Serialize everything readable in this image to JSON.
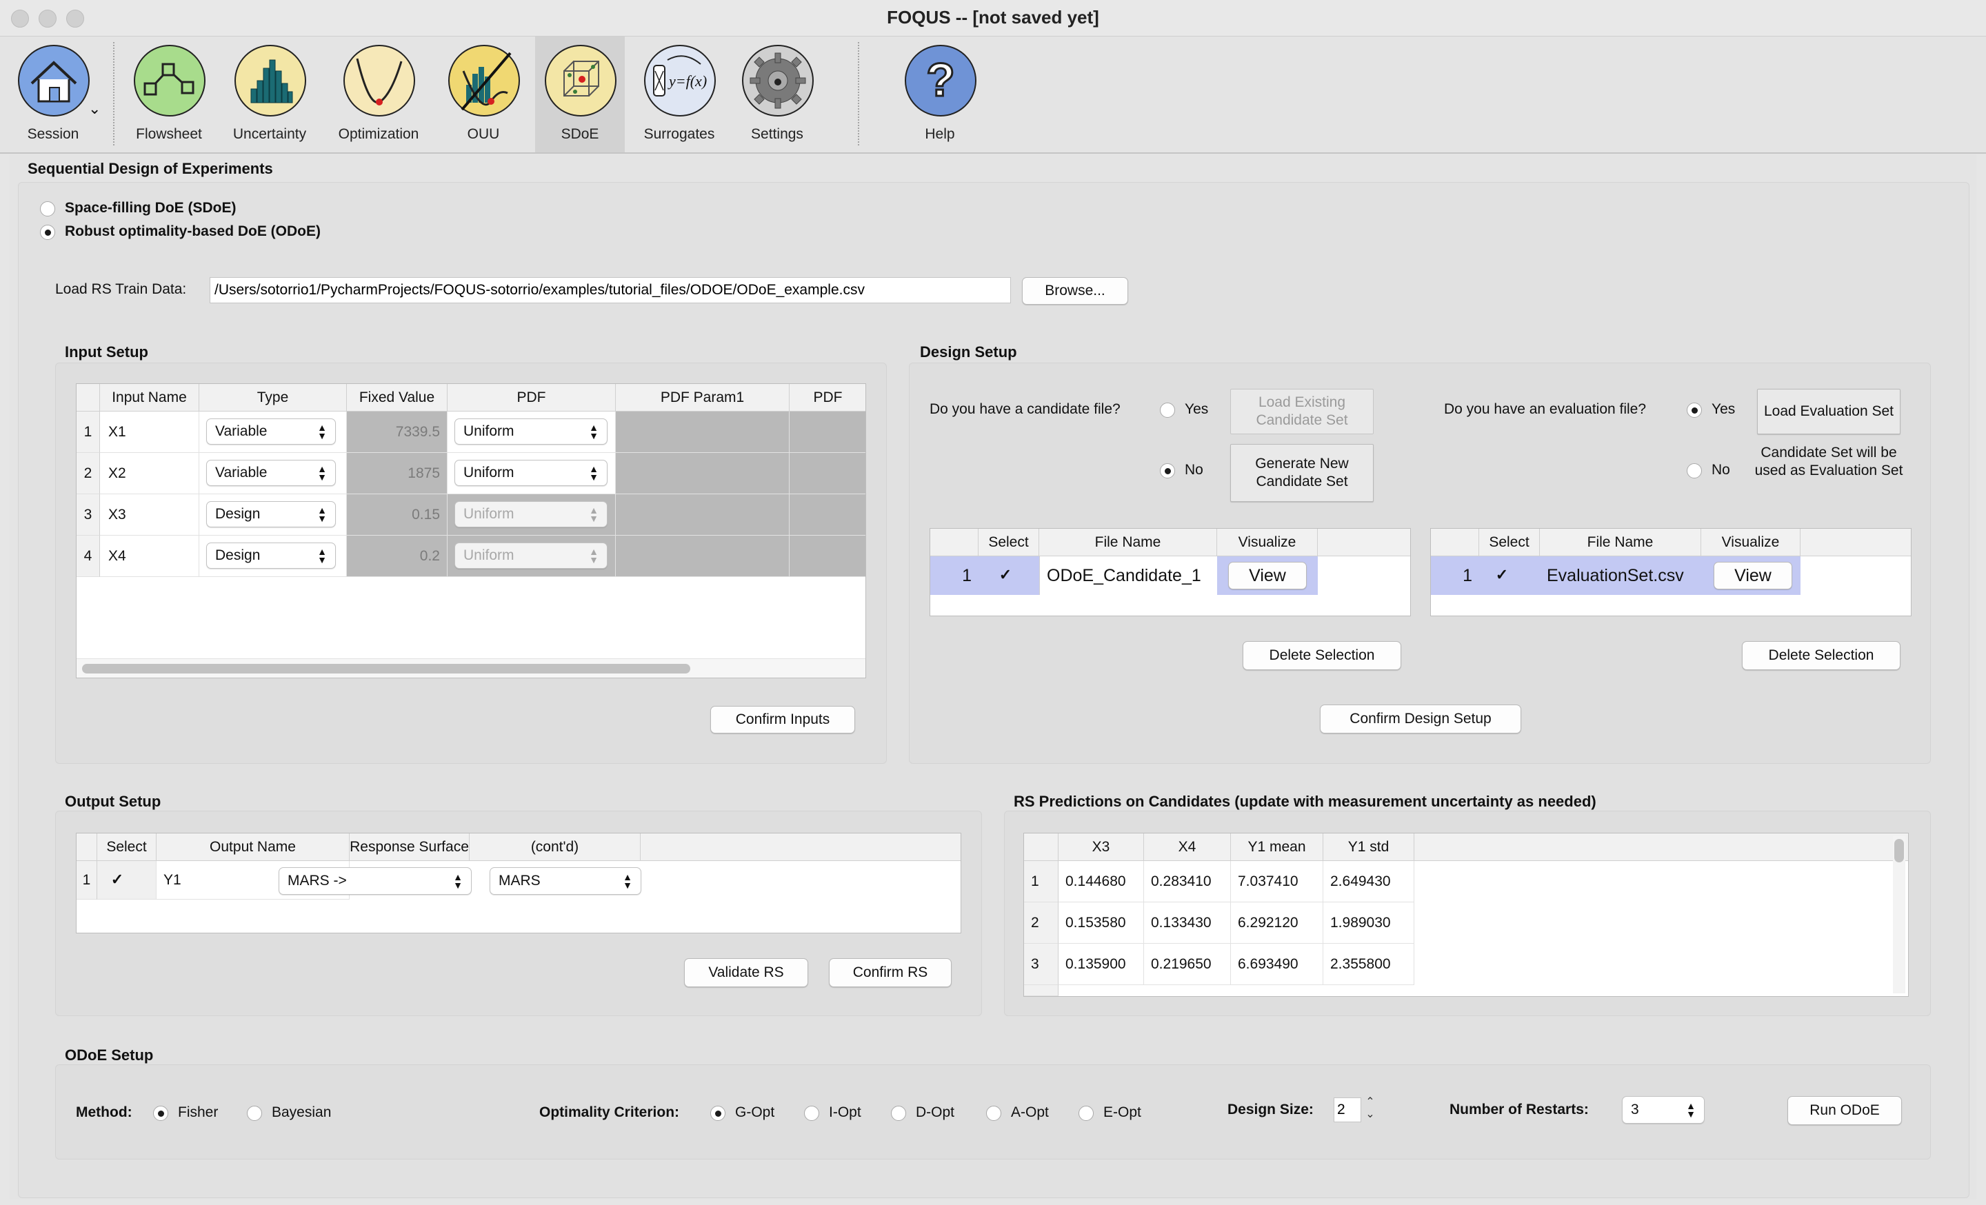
{
  "window": {
    "title": "FOQUS -- [not saved yet]"
  },
  "toolbar": {
    "items": [
      {
        "label": "Session"
      },
      {
        "label": "Flowsheet"
      },
      {
        "label": "Uncertainty"
      },
      {
        "label": "Optimization"
      },
      {
        "label": "OUU"
      },
      {
        "label": "SDoE"
      },
      {
        "label": "Surrogates"
      },
      {
        "label": "Settings"
      },
      {
        "label": "Help"
      }
    ],
    "active": "SDoE"
  },
  "page": {
    "title": "Sequential Design of Experiments",
    "mode_options": [
      "Space-filling DoE (SDoE)",
      "Robust optimality-based DoE (ODoE)"
    ],
    "mode_selected": 1,
    "load_label": "Load RS Train Data:",
    "load_path": "/Users/sotorrio1/PycharmProjects/FOQUS-sotorrio/examples/tutorial_files/ODOE/ODoE_example.csv",
    "browse_label": "Browse..."
  },
  "input_setup": {
    "title": "Input Setup",
    "columns": [
      "Input Name",
      "Type",
      "Fixed Value",
      "PDF",
      "PDF Param1",
      "PDF"
    ],
    "rows": [
      {
        "num": "1",
        "name": "X1",
        "type": "Variable",
        "fixed": "7339.5",
        "pdf": "Uniform"
      },
      {
        "num": "2",
        "name": "X2",
        "type": "Variable",
        "fixed": "1875",
        "pdf": "Uniform"
      },
      {
        "num": "3",
        "name": "X3",
        "type": "Design",
        "fixed": "0.15",
        "pdf": "Uniform"
      },
      {
        "num": "4",
        "name": "X4",
        "type": "Design",
        "fixed": "0.2",
        "pdf": "Uniform"
      }
    ],
    "confirm_label": "Confirm Inputs"
  },
  "design_setup": {
    "title": "Design Setup",
    "candidate_question": "Do you have a candidate file?",
    "yes": "Yes",
    "no": "No",
    "load_existing_label": "Load Existing Candidate Set",
    "generate_new_label": "Generate New Candidate Set",
    "eval_question": "Do you have an evaluation file?",
    "load_eval_label": "Load Evaluation Set",
    "eval_note": "Candidate Set will be used as Evaluation Set",
    "table_columns": [
      "Select",
      "File Name",
      "Visualize"
    ],
    "candidate_row": {
      "num": "1",
      "file": "ODoE_Candidate_1",
      "view": "View"
    },
    "eval_row": {
      "num": "1",
      "file": "EvaluationSet.csv",
      "view": "View"
    },
    "delete_label": "Delete Selection",
    "confirm_label": "Confirm Design Setup"
  },
  "output_setup": {
    "title": "Output Setup",
    "columns": [
      "Select",
      "Output Name",
      "Response Surface",
      "(cont'd)"
    ],
    "row": {
      "num": "1",
      "name": "Y1",
      "rs": "MARS ->",
      "cont": "MARS"
    },
    "validate_label": "Validate RS",
    "confirm_label": "Confirm RS"
  },
  "rs_predictions": {
    "title": "RS Predictions on Candidates (update with measurement uncertainty as needed)",
    "columns": [
      "X3",
      "X4",
      "Y1 mean",
      "Y1 std"
    ],
    "rows": [
      {
        "num": "1",
        "cells": [
          "0.144680",
          "0.283410",
          "7.037410",
          "2.649430"
        ]
      },
      {
        "num": "2",
        "cells": [
          "0.153580",
          "0.133430",
          "6.292120",
          "1.989030"
        ]
      },
      {
        "num": "3",
        "cells": [
          "0.135900",
          "0.219650",
          "6.693490",
          "2.355800"
        ]
      }
    ]
  },
  "odoe_setup": {
    "title": "ODoE Setup",
    "method_label": "Method:",
    "methods": [
      "Fisher",
      "Bayesian"
    ],
    "method_selected": "Fisher",
    "criterion_label": "Optimality Criterion:",
    "criteria": [
      "G-Opt",
      "I-Opt",
      "D-Opt",
      "A-Opt",
      "E-Opt"
    ],
    "criterion_selected": "G-Opt",
    "design_size_label": "Design Size:",
    "design_size": "2",
    "restarts_label": "Number of Restarts:",
    "restarts": "3",
    "run_label": "Run ODoE"
  },
  "colors": {
    "selection": "#c3c9f3",
    "disabled_cell": "#b9b9b9",
    "panel": "#dedede",
    "help": "#6f93d6"
  }
}
